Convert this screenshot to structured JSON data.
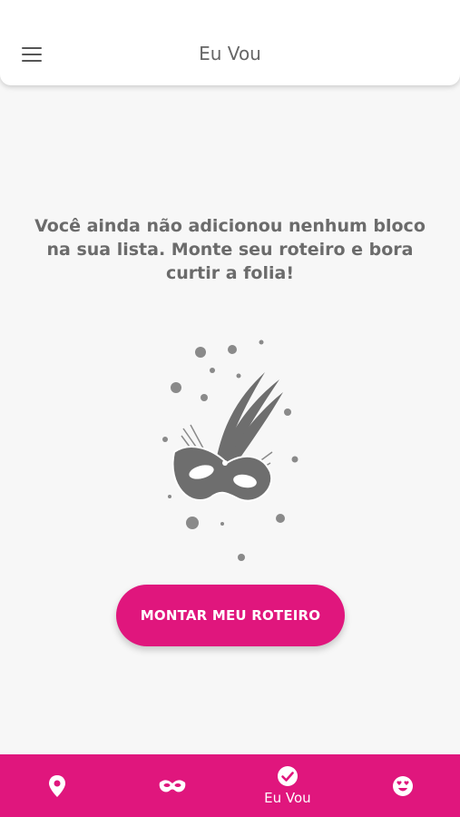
{
  "header": {
    "title": "Eu Vou",
    "menu_icon": "hamburger-menu-icon"
  },
  "empty_state": {
    "message": "Você ainda não adicionou nenhum bloco na sua lista. Monte seu roteiro e bora curtir a folia!",
    "illustration": "carnival-mask-icon",
    "button_label": "MONTAR MEU ROTEIRO"
  },
  "tabbar": {
    "tabs": [
      {
        "icon": "location-pin-icon",
        "label": "",
        "active": false
      },
      {
        "icon": "mask-icon",
        "label": "",
        "active": false
      },
      {
        "icon": "check-circle-icon",
        "label": "Eu Vou",
        "active": true
      },
      {
        "icon": "smiley-heart-icon",
        "label": "",
        "active": false
      }
    ]
  },
  "colors": {
    "accent": "#e0167d",
    "background": "#f7f7f7",
    "text": "#6b6b6b"
  }
}
